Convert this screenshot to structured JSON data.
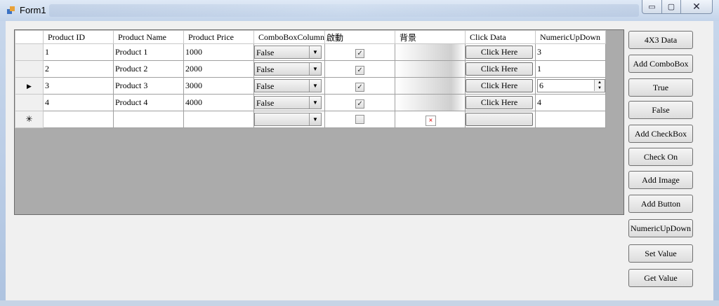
{
  "window": {
    "title": "Form1",
    "minimize": "▭",
    "maximize": "▢",
    "close": "✕"
  },
  "grid": {
    "columns": [
      "Product ID",
      "Product Name",
      "Product Price",
      "ComboBoxColumn",
      "啟動",
      "背景",
      "Click Data",
      "NumericUpDown"
    ],
    "rows": [
      {
        "indicator": "",
        "id": "1",
        "name": "Product 1",
        "price": "1000",
        "combo": "False",
        "checked": true,
        "button": "Click Here",
        "numeric": "3"
      },
      {
        "indicator": "",
        "id": "2",
        "name": "Product 2",
        "price": "2000",
        "combo": "False",
        "checked": true,
        "button": "Click Here",
        "numeric": "1"
      },
      {
        "indicator": "▶",
        "id": "3",
        "name": "Product 3",
        "price": "3000",
        "combo": "False",
        "checked": true,
        "button": "Click Here",
        "numeric": "6"
      },
      {
        "indicator": "",
        "id": "4",
        "name": "Product 4",
        "price": "4000",
        "combo": "False",
        "checked": true,
        "button": "Click Here",
        "numeric": "4"
      }
    ],
    "new_row_indicator": "✳"
  },
  "buttons": [
    "4X3 Data",
    "Add ComboBox",
    "True",
    "False",
    "Add CheckBox",
    "Check On",
    "Add Image",
    "Add Button",
    "NumericUpDown",
    "Set Value",
    "Get Value"
  ],
  "icons": {
    "app": "winforms-app-icon",
    "combo_arrow": "▼",
    "check": "✓",
    "broken_image": "×",
    "spin_up": "▲",
    "spin_down": "▼"
  }
}
